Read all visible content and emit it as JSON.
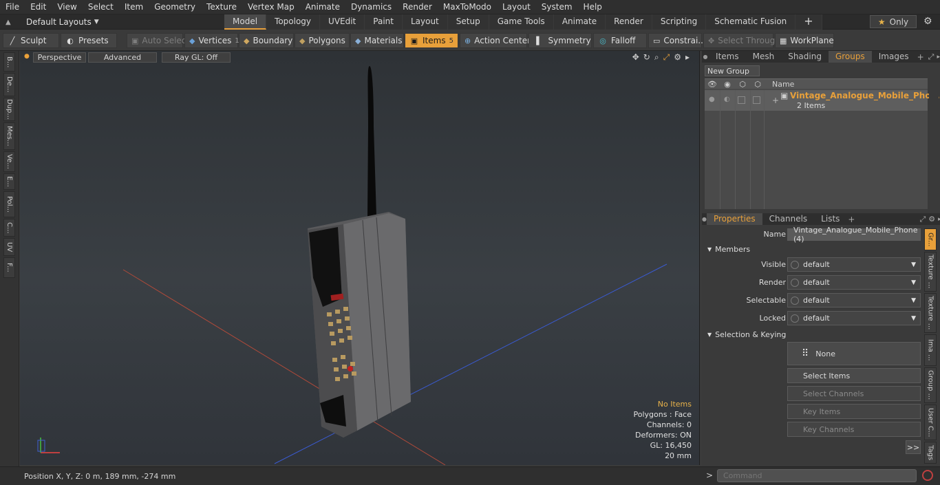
{
  "menu": [
    "File",
    "Edit",
    "View",
    "Select",
    "Item",
    "Geometry",
    "Texture",
    "Vertex Map",
    "Animate",
    "Dynamics",
    "Render",
    "MaxToModo",
    "Layout",
    "System",
    "Help"
  ],
  "layout_selector": "Default Layouts",
  "mode_tabs": [
    "Model",
    "Topology",
    "UVEdit",
    "Paint",
    "Layout",
    "Setup",
    "Game Tools",
    "Animate",
    "Render",
    "Scripting",
    "Schematic Fusion"
  ],
  "active_mode": "Model",
  "only_label": "Only",
  "toolbar": {
    "sculpt": "Sculpt",
    "presets": "Presets",
    "auto_select": "Auto Select",
    "vertices": "Vertices",
    "vertices_count": "1",
    "boundary": "Boundary",
    "polygons": "Polygons",
    "materials": "Materials",
    "items": "Items",
    "items_count": "5",
    "action_center": "Action Center",
    "symmetry": "Symmetry",
    "falloff": "Falloff",
    "constraints": "Constrai...",
    "select_through": "Select Through",
    "workplane": "WorkPlane"
  },
  "left_tabs": [
    "B...",
    "De...",
    "Dup...",
    "Mes...",
    "Ve...",
    "E...",
    "Pol...",
    "C...",
    "UV",
    "F..."
  ],
  "viewport": {
    "view": "Perspective",
    "shading": "Advanced",
    "raygl": "Ray GL: Off",
    "info": {
      "items": "No Items",
      "polygons": "Polygons : Face",
      "channels": "Channels: 0",
      "deformers": "Deformers: ON",
      "gl": "GL: 16,450",
      "scale": "20 mm"
    }
  },
  "status": {
    "position": "Position X, Y, Z:   0 m, 189 mm, -274 mm"
  },
  "top_panel": {
    "tabs": [
      "Items",
      "Mesh ...",
      "Shading",
      "Groups",
      "Images"
    ],
    "active": "Groups",
    "new_group": "New Group",
    "col_name": "Name",
    "group_name": "Vintage_Analogue_Mobile_Phon...",
    "group_items": "2 Items"
  },
  "bottom_panel": {
    "tabs": [
      "Properties",
      "Channels",
      "Lists"
    ],
    "active": "Properties",
    "name_label": "Name",
    "name_value": "Vintage_Analogue_Mobile_Phone (4)",
    "members": "Members",
    "visible_label": "Visible",
    "render_label": "Render",
    "selectable_label": "Selectable",
    "locked_label": "Locked",
    "default": "default",
    "sel_keying": "Selection & Keying",
    "none": "None",
    "select_items": "Select Items",
    "select_channels": "Select Channels",
    "key_items": "Key Items",
    "key_channels": "Key Channels",
    "more": ">>"
  },
  "right_vtabs": [
    "Gr...",
    "Texture ...",
    "Texture ...",
    "Ima ...",
    "Group ...",
    "User C...",
    "Tags"
  ],
  "command": {
    "placeholder": "Command",
    "prompt": ">"
  }
}
